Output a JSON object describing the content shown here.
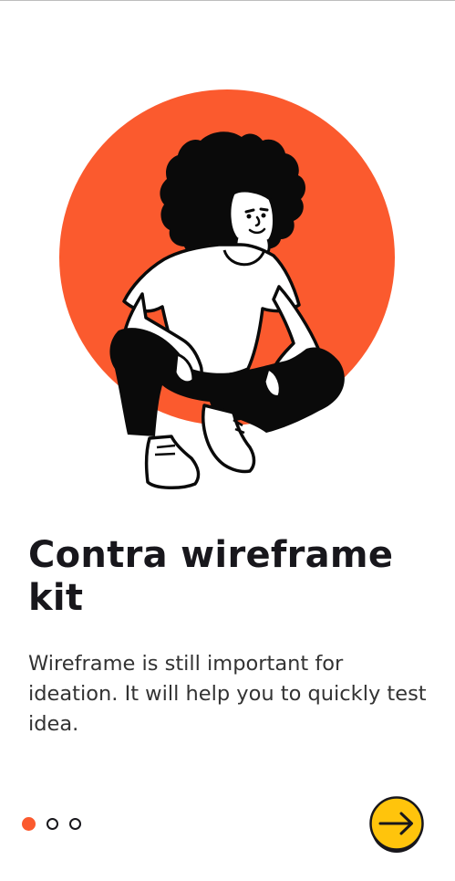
{
  "onboarding": {
    "title": "Contra wireframe kit",
    "description": "Wireframe is still important for ideation. It will help you to quickly test idea."
  },
  "pagination": {
    "total_pages": 3,
    "current_page": 1,
    "dots": [
      {
        "state": "active"
      },
      {
        "state": "inactive"
      },
      {
        "state": "inactive"
      }
    ]
  },
  "next_button": {
    "icon": "arrow-right-icon"
  },
  "hero": {
    "illustration": "crouching-person-illustration"
  },
  "colors": {
    "accent": "#fb5a2e",
    "button": "#ffc40c",
    "ink": "#18171c",
    "text_secondary": "#333333",
    "background": "#ffffff"
  }
}
